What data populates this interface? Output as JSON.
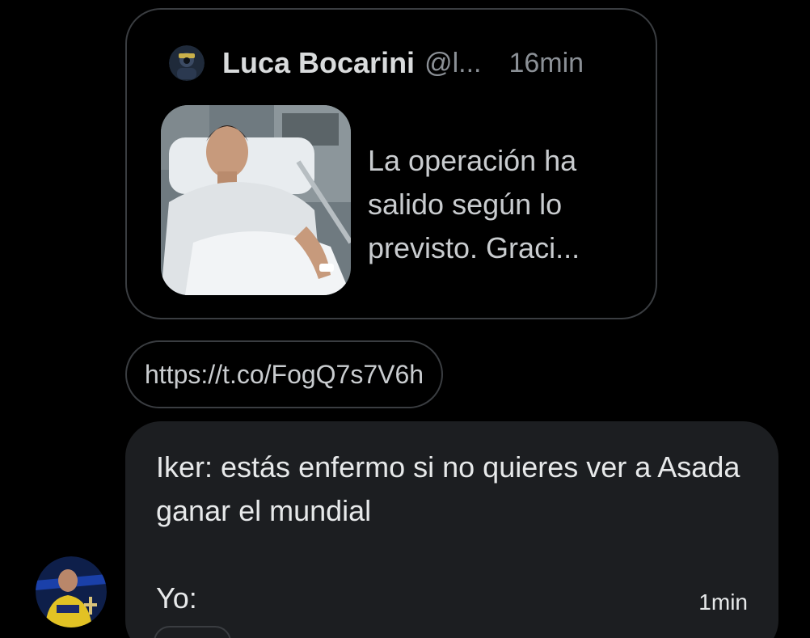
{
  "quoted_tweet": {
    "author_name": "Luca Bocarini",
    "handle": "@l...",
    "time": "16min",
    "text": "La operación ha salido según lo previsto. Graci...",
    "avatar_icon": "user-avatar-icon",
    "media_icon": "hospital-photo"
  },
  "link": {
    "url": "https://t.co/FogQ7s7V6h"
  },
  "message": {
    "text": "Iker: estás enfermo si no quieres ver a Asada ganar el mundial\n\nYo:",
    "time": "1min",
    "sender_avatar_icon": "rider-avatar-icon"
  },
  "colors": {
    "background": "#000000",
    "bubble": "#1c1e21",
    "border": "#3a3d41",
    "muted_text": "#8b9096"
  }
}
